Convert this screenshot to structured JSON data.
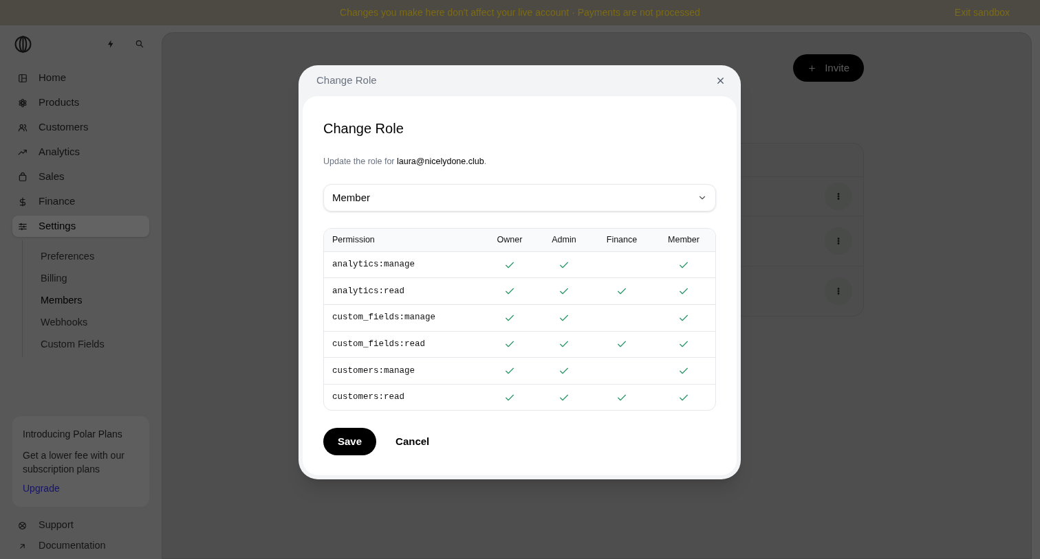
{
  "banner": {
    "message": "Changes you make here don't affect your live account · Payments are not processed",
    "action": "Exit sandbox"
  },
  "sidebar": {
    "items": [
      {
        "label": "Home",
        "selected": false
      },
      {
        "label": "Products",
        "selected": false
      },
      {
        "label": "Customers",
        "selected": false
      },
      {
        "label": "Analytics",
        "selected": false
      },
      {
        "label": "Sales",
        "selected": false
      },
      {
        "label": "Finance",
        "selected": false
      },
      {
        "label": "Settings",
        "selected": true,
        "expanded": true,
        "children": [
          {
            "label": "Preferences",
            "selected": false
          },
          {
            "label": "Billing",
            "selected": false
          },
          {
            "label": "Members",
            "selected": true
          },
          {
            "label": "Webhooks",
            "selected": false
          },
          {
            "label": "Custom Fields",
            "selected": false
          }
        ]
      }
    ],
    "promo": {
      "title": "Introducing Polar Plans",
      "text": "Get a lower fee with our subscription plans",
      "link": "Upgrade"
    },
    "footer_links": [
      {
        "label": "Support"
      },
      {
        "label": "Documentation"
      }
    ]
  },
  "main": {
    "invite_button": "Invite",
    "member_rows": [
      {
        "has_menu": false
      },
      {
        "has_menu": true
      },
      {
        "has_menu": true
      },
      {
        "has_menu": true
      }
    ]
  },
  "modal": {
    "title": "Change Role",
    "heading": "Change Role",
    "description": "Update the role for **laura@nicelydone.club**.",
    "role_select": {
      "value": "Member"
    },
    "permissions": {
      "columns": [
        "Permission",
        "Owner",
        "Admin",
        "Finance",
        "Member"
      ],
      "rows": [
        {
          "permission": "analytics:manage",
          "grants": [
            true,
            true,
            false,
            true
          ]
        },
        {
          "permission": "analytics:read",
          "grants": [
            true,
            true,
            true,
            true
          ]
        },
        {
          "permission": "custom_fields:manage",
          "grants": [
            true,
            true,
            false,
            true
          ]
        },
        {
          "permission": "custom_fields:read",
          "grants": [
            true,
            true,
            true,
            true
          ]
        },
        {
          "permission": "customers:manage",
          "grants": [
            true,
            true,
            false,
            true
          ]
        },
        {
          "permission": "customers:read",
          "grants": [
            true,
            true,
            true,
            true
          ]
        }
      ]
    },
    "buttons": {
      "save": "Save",
      "cancel": "Cancel"
    }
  }
}
